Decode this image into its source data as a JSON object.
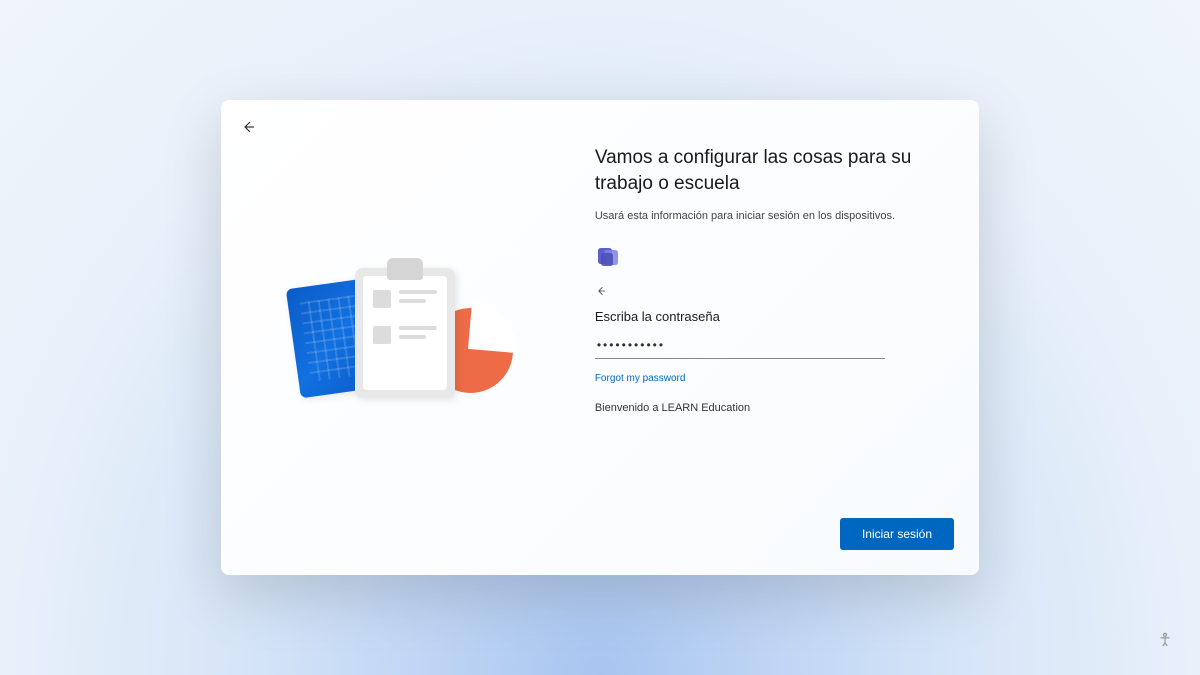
{
  "header": {
    "title": "Vamos a configurar las cosas para su trabajo o escuela",
    "subtitle": "Usará esta información para iniciar sesión en los dispositivos."
  },
  "form": {
    "password_label": "Escriba la contraseña",
    "password_value": "•••••••••••",
    "forgot_link": "Forgot my password",
    "welcome_text": "Bienvenido a LEARN Education"
  },
  "actions": {
    "signin_label": "Iniciar sesión"
  },
  "colors": {
    "primary": "#0067c0",
    "accent_orange": "#ed6c47",
    "accent_blue": "#0a5cc7"
  }
}
